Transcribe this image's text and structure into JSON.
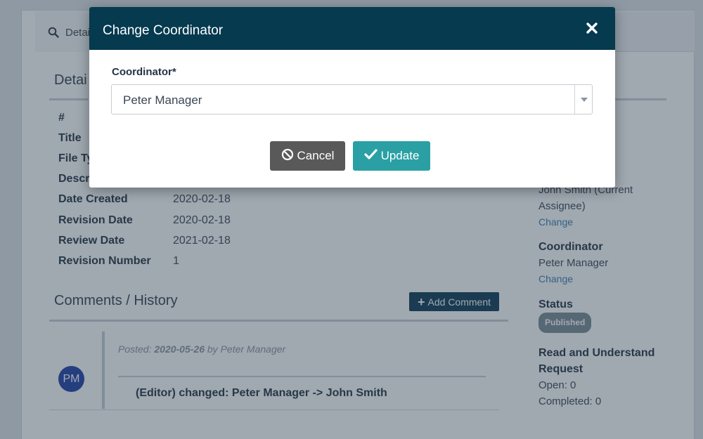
{
  "tabs": {
    "active_label": "Detai"
  },
  "details": {
    "title": "Detai",
    "rows": [
      {
        "label": "#",
        "value": ""
      },
      {
        "label": "Title",
        "value": ""
      },
      {
        "label": "File Ty",
        "value": ""
      },
      {
        "label": "Descr",
        "value": ""
      },
      {
        "label": "Date Created",
        "value": "2020-02-18"
      },
      {
        "label": "Revision Date",
        "value": "2020-02-18"
      },
      {
        "label": "Review Date",
        "value": "2021-02-18"
      },
      {
        "label": "Revision Number",
        "value": "1"
      }
    ]
  },
  "comments": {
    "title": "Comments / History",
    "add_label": "Add Comment",
    "items": [
      {
        "avatar": "PM",
        "posted_prefix": "Posted:",
        "posted_date": "2020-05-26",
        "posted_suffix": "by Peter Manager",
        "text": "(Editor) changed: Peter Manager -> John Smith"
      }
    ]
  },
  "sidebar": {
    "assignee_line1": "John Smith (Current",
    "assignee_line2": "Assignee)",
    "assignee_change": "Change",
    "coordinator_heading": "Coordinator",
    "coordinator_value": "Peter Manager",
    "coordinator_change": "Change",
    "status_heading": "Status",
    "status_badge": "Published",
    "ru_heading_line1": "Read and Understand",
    "ru_heading_line2": "Request",
    "ru_open": "Open: 0",
    "ru_completed": "Completed: 0"
  },
  "modal": {
    "title": "Change Coordinator",
    "field_label": "Coordinator*",
    "selected_value": "Peter Manager",
    "cancel_label": "Cancel",
    "update_label": "Update"
  },
  "colors": {
    "modal_header": "#053a4f",
    "cancel_button": "#595959",
    "update_button": "#2aa0a4",
    "add_comment_button": "#0c3a52",
    "avatar": "#1f3fa6",
    "link": "#3b7fb1"
  },
  "icons": {
    "tab": "search-icon",
    "close": "close-icon",
    "cancel": "ban-icon",
    "update": "check-icon",
    "add": "plus-icon",
    "select": "chevron-down-icon"
  }
}
